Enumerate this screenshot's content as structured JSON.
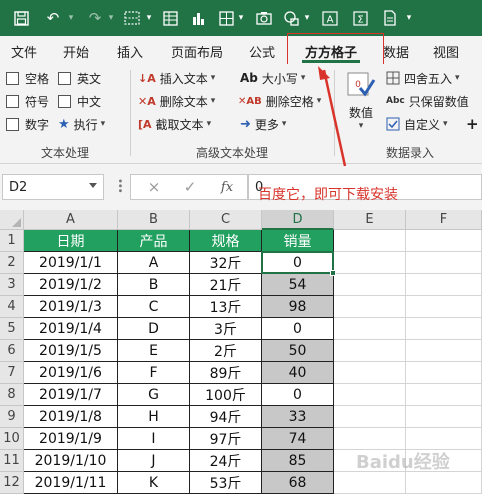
{
  "qat": {
    "icons": [
      "save-icon",
      "undo-icon",
      "redo-icon",
      "table-icon",
      "form-icon",
      "chart-icon",
      "grid-icon",
      "camera-icon",
      "shapes-icon",
      "text-frame-icon",
      "sigma-icon",
      "file-icon"
    ]
  },
  "tabs": [
    {
      "label": "文件"
    },
    {
      "label": "开始"
    },
    {
      "label": "插入"
    },
    {
      "label": "页面布局"
    },
    {
      "label": "公式"
    },
    {
      "label": "方方格子",
      "active": true
    },
    {
      "label": "数据"
    },
    {
      "label": "视图"
    }
  ],
  "ribbon": {
    "text_processing": {
      "checkboxes": [
        {
          "label": "空格",
          "checked": false
        },
        {
          "label": "英文",
          "checked": false
        },
        {
          "label": "符号",
          "checked": false
        },
        {
          "label": "中文",
          "checked": false
        },
        {
          "label": "数字",
          "checked": false
        }
      ],
      "execute_label": "执行",
      "group_label": "文本处理"
    },
    "advanced_text": {
      "insert_text": "插入文本",
      "delete_text": "删除文本",
      "cut_text": "截取文本",
      "case": "大小写",
      "delete_spaces": "删除空格",
      "more": "更多",
      "group_label": "高级文本处理"
    },
    "data_entry": {
      "value_button": "数值",
      "round": "四舍五入",
      "keep_values": "只保留数值",
      "custom": "自定义",
      "group_label": "数据录入",
      "add_symbol": "+"
    }
  },
  "formula_bar": {
    "cell_ref": "D2",
    "cancel": "×",
    "confirm": "✓",
    "fx": "fx",
    "value": "0"
  },
  "annotation": "百度它，即可下载安装",
  "grid": {
    "columns": [
      "A",
      "B",
      "C",
      "D",
      "E",
      "F"
    ],
    "selected_column": "D",
    "rows": [
      1,
      2,
      3,
      4,
      5,
      6,
      7,
      8,
      9,
      10,
      11,
      12
    ],
    "header": [
      "日期",
      "产品",
      "规格",
      "销量"
    ],
    "data": [
      [
        "2019/1/1",
        "A",
        "32斤",
        "0"
      ],
      [
        "2019/1/2",
        "B",
        "21斤",
        "54"
      ],
      [
        "2019/1/3",
        "C",
        "13斤",
        "98"
      ],
      [
        "2019/1/4",
        "D",
        "3斤",
        "0"
      ],
      [
        "2019/1/5",
        "E",
        "2斤",
        "50"
      ],
      [
        "2019/1/6",
        "F",
        "89斤",
        "40"
      ],
      [
        "2019/1/7",
        "G",
        "100斤",
        "0"
      ],
      [
        "2019/1/8",
        "H",
        "94斤",
        "33"
      ],
      [
        "2019/1/9",
        "I",
        "97斤",
        "74"
      ],
      [
        "2019/1/10",
        "J",
        "24斤",
        "85"
      ],
      [
        "2019/1/11",
        "K",
        "53斤",
        "68"
      ]
    ]
  },
  "watermark": "Baidu经验",
  "colors": {
    "brand": "#217346",
    "table_header": "#22a060",
    "annotation": "#d9342b",
    "shaded_cell": "#c8c8c8"
  }
}
